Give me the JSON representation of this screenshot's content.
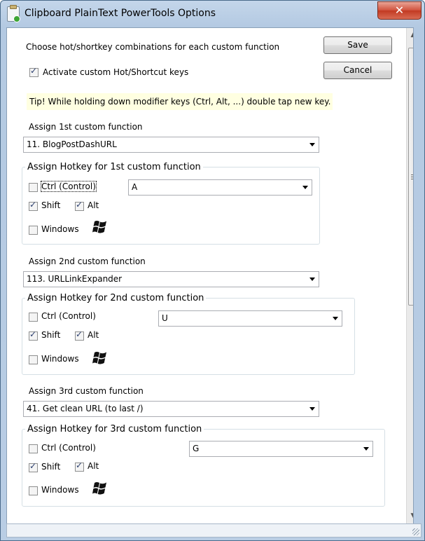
{
  "window": {
    "title": "Clipboard PlainText PowerTools Options",
    "close_glyph": "✕"
  },
  "header": {
    "choose_label": "Choose hot/shortkey combinations for each custom function",
    "activate_label": "Activate custom Hot/Shortcut keys",
    "activate_checked": true,
    "save_label": "Save",
    "cancel_label": "Cancel",
    "tip": "Tip! While holding down modifier keys (Ctrl, Alt, ...) double tap new key."
  },
  "functions": [
    {
      "assign_label": "Assign 1st custom function",
      "selected": "11. BlogPostDashURL",
      "group_title": "Assign Hotkey for 1st custom function",
      "ctrl_label": "Ctrl (Control)",
      "ctrl": false,
      "shift_label": "Shift",
      "shift": true,
      "alt_label": "Alt",
      "alt": true,
      "windows_label": "Windows",
      "windows": false,
      "key": "A"
    },
    {
      "assign_label": "Assign 2nd custom function",
      "selected": "113. URLLinkExpander",
      "group_title": "Assign Hotkey for 2nd custom function",
      "ctrl_label": "Ctrl (Control)",
      "ctrl": false,
      "shift_label": "Shift",
      "shift": true,
      "alt_label": "Alt",
      "alt": true,
      "windows_label": "Windows",
      "windows": false,
      "key": "U"
    },
    {
      "assign_label": "Assign 3rd custom function",
      "selected": "41. Get clean URL (to last /)",
      "group_title": "Assign Hotkey for 3rd custom function",
      "ctrl_label": "Ctrl (Control)",
      "ctrl": false,
      "shift_label": "Shift",
      "shift": true,
      "alt_label": "Alt",
      "alt": true,
      "windows_label": "Windows",
      "windows": false,
      "key": "G"
    }
  ],
  "icons": {
    "app": "clipboard-app-icon",
    "close": "close-icon",
    "windows": "windows-logo-icon"
  },
  "colors": {
    "tip_background": "#ffffe1",
    "close_button": "#c23a22",
    "title_bar": "#b9cde4"
  }
}
